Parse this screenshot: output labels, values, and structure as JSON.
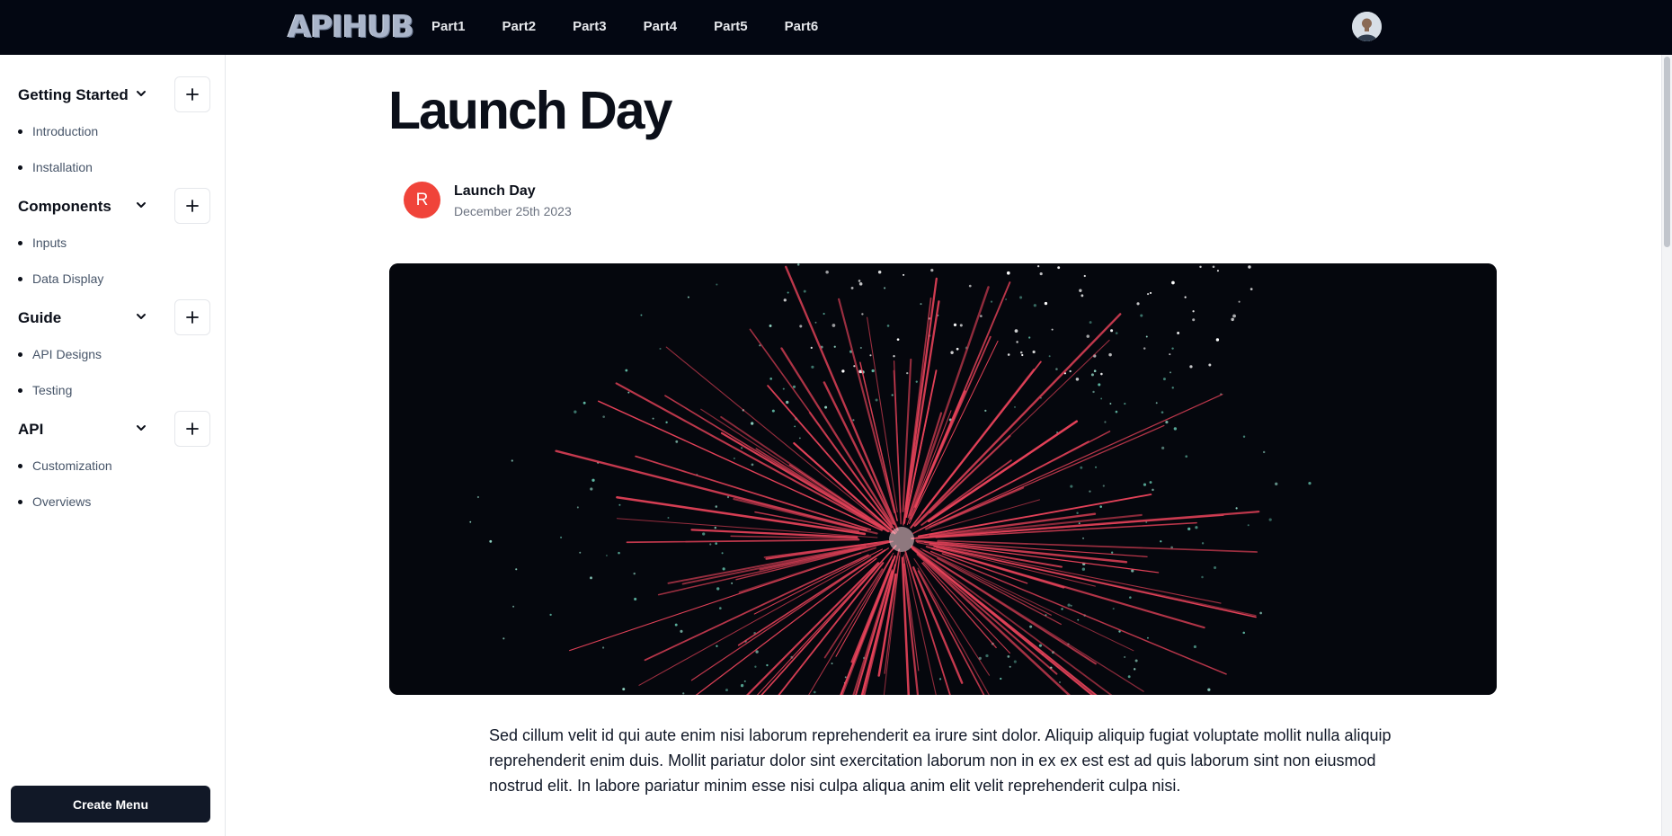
{
  "app": {
    "logo": "APIHUB"
  },
  "nav": [
    "Part1",
    "Part2",
    "Part3",
    "Part4",
    "Part5",
    "Part6"
  ],
  "sidebar": {
    "groups": [
      {
        "title": "Getting Started",
        "items": [
          "Introduction",
          "Installation"
        ]
      },
      {
        "title": "Components",
        "items": [
          "Inputs",
          "Data Display"
        ]
      },
      {
        "title": "Guide",
        "items": [
          "API Designs",
          "Testing"
        ]
      },
      {
        "title": "API",
        "items": [
          "Customization",
          "Overviews"
        ]
      }
    ],
    "create_label": "Create Menu"
  },
  "post": {
    "title": "Launch Day",
    "author_initial": "R",
    "author_name": "Launch Day",
    "date": "December 25th 2023",
    "body": "Sed cillum velit id qui aute enim nisi laborum reprehenderit ea irure sint dolor. Aliquip aliquip fugiat voluptate mollit nulla aliquip reprehenderit enim duis. Mollit pariatur dolor sint exercitation laborum non in ex ex est est ad quis laborum sint non eiusmod nostrud elit. In labore pariatur minim esse nisi culpa aliqua anim elit velit reprehenderit culpa nisi."
  },
  "colors": {
    "topbar": "#030712",
    "avatar_bg": "#f0443a",
    "firework": "#e8435a",
    "create_button": "#111827"
  }
}
